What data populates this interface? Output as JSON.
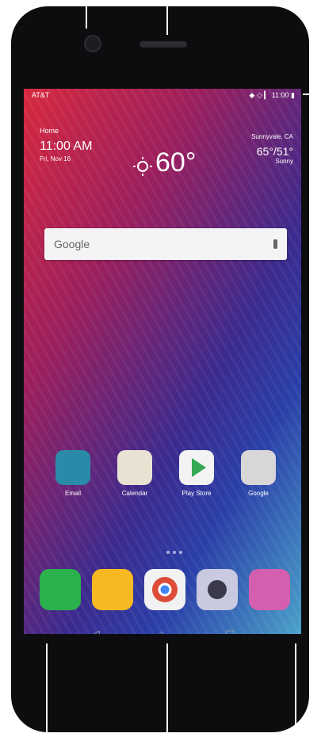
{
  "status_bar": {
    "carrier": "AT&T",
    "right": "◆ ◇ ▎ 11:00 ▮"
  },
  "clock_widget": {
    "location": "Home",
    "time": "11:00 AM",
    "date": "Fri, Nov 16"
  },
  "weather_widget": {
    "temperature": "60°",
    "location": "Sunnyvale, CA",
    "hi_lo": "65°/51°",
    "condition": "Sunny"
  },
  "search": {
    "logo_text": "Google"
  },
  "apps": [
    {
      "label": "Email",
      "icon": "email-icon",
      "color": "#2a8aa7"
    },
    {
      "label": "Calendar",
      "icon": "calendar-icon",
      "color": "#e9e2d2"
    },
    {
      "label": "Play Store",
      "icon": "play-store-icon",
      "color": "#f3f3f3"
    },
    {
      "label": "Google",
      "icon": "google-folder-icon",
      "color": "#d8d6d6"
    }
  ],
  "dock": [
    {
      "icon": "phone-icon",
      "color": "#2bb24c"
    },
    {
      "icon": "messaging-icon",
      "color": "#f7b921"
    },
    {
      "icon": "chrome-icon",
      "color": "#f2f2f2"
    },
    {
      "icon": "camera-icon",
      "color": "#c9c9df"
    },
    {
      "icon": "gallery-icon",
      "color": "#d45fb0"
    }
  ],
  "nav": {
    "back": "◁",
    "home": "○",
    "recents": "▢"
  }
}
